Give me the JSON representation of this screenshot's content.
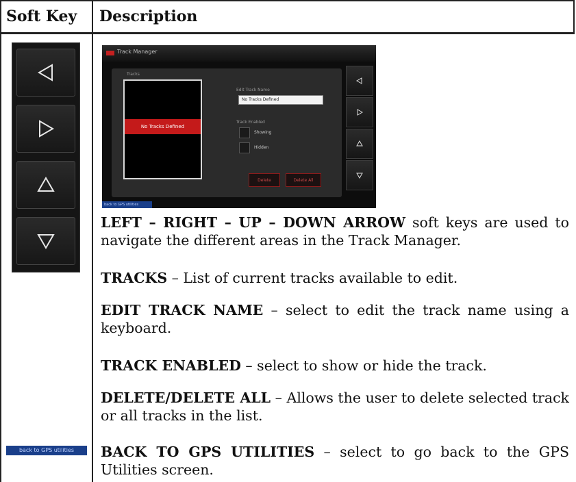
{
  "header": {
    "soft_key": "Soft Key",
    "description": "Description"
  },
  "soft_keys": [
    {
      "name": "left-arrow",
      "icon": "left-triangle-icon"
    },
    {
      "name": "right-arrow",
      "icon": "right-triangle-icon"
    },
    {
      "name": "up-arrow",
      "icon": "up-triangle-icon"
    },
    {
      "name": "down-arrow",
      "icon": "down-triangle-icon"
    }
  ],
  "back_key_label": "back to GPS utilities",
  "screenshot": {
    "title": "Track Manager",
    "list_label": "Tracks",
    "list_item": "No Tracks Defined",
    "edit_label": "Edit Track Name",
    "edit_value": "No Tracks Defined",
    "enabled_label": "Track Enabled",
    "opt_showing": "Showing",
    "opt_hidden": "Hidden",
    "delete_btn": "Delete",
    "delete_all_btn": "Delete All",
    "back_link": "back to GPS utilities",
    "accent": "#c41a1a"
  },
  "rows": [
    {
      "term": "LEFT – RIGHT – UP – DOWN ARROW",
      "text": " soft keys are used to navigate the different areas in the Track Manager."
    },
    {
      "term": "TRACKS",
      "text": " – List of current tracks available to edit."
    },
    {
      "term": "EDIT TRACK NAME",
      "text": " – select to edit the track name using a keyboard."
    },
    {
      "term": "TRACK ENABLED",
      "text": " – select to show or hide the track."
    },
    {
      "term": "DELETE/DELETE ALL",
      "text": " – Allows the user to delete selected track or all tracks in the list."
    },
    {
      "term": "BACK TO GPS UTILITIES",
      "text": " – select to go back to the GPS Utilities screen."
    }
  ]
}
